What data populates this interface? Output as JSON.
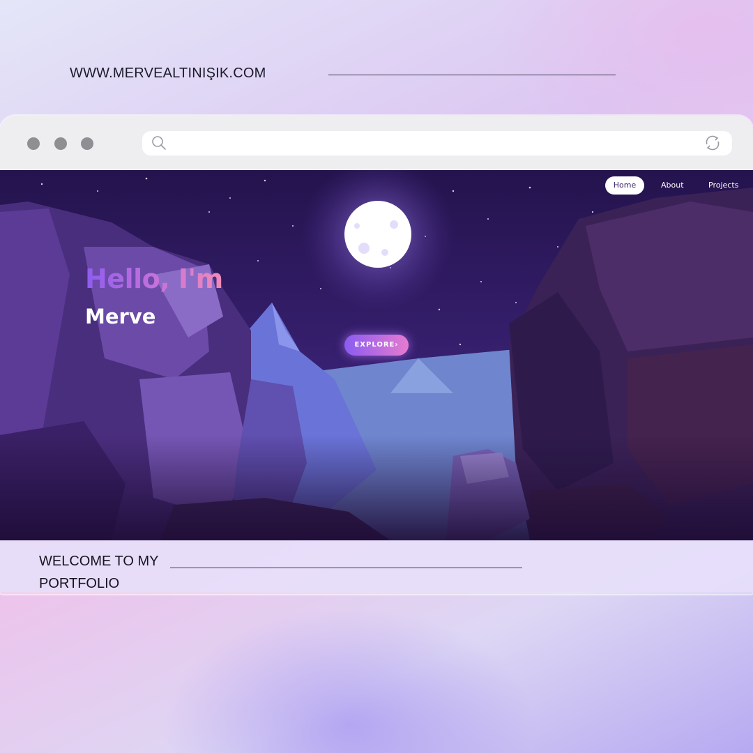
{
  "site": {
    "url": "WWW.MERVEALTINIŞIK.COM"
  },
  "browser": {
    "window_dots": [
      "close-dot",
      "minimize-dot",
      "maximize-dot"
    ],
    "address_placeholder": "",
    "icons": {
      "search": "search-icon",
      "refresh": "refresh-icon"
    }
  },
  "hero": {
    "nav": [
      {
        "label": "Home",
        "active": true
      },
      {
        "label": "About",
        "active": false
      },
      {
        "label": "Projects",
        "active": false
      }
    ],
    "greeting": "Hello, I'm",
    "name": "Merve",
    "cta_label": "EXPLORE›"
  },
  "caption": {
    "line1": "WELCOME TO MY",
    "line2": "PORTFOLIO"
  },
  "colors": {
    "accent_purple": "#8d5cf0",
    "accent_pink": "#f28ab8",
    "night_sky": "#2c1656",
    "chrome_gray": "#eeeef0"
  }
}
